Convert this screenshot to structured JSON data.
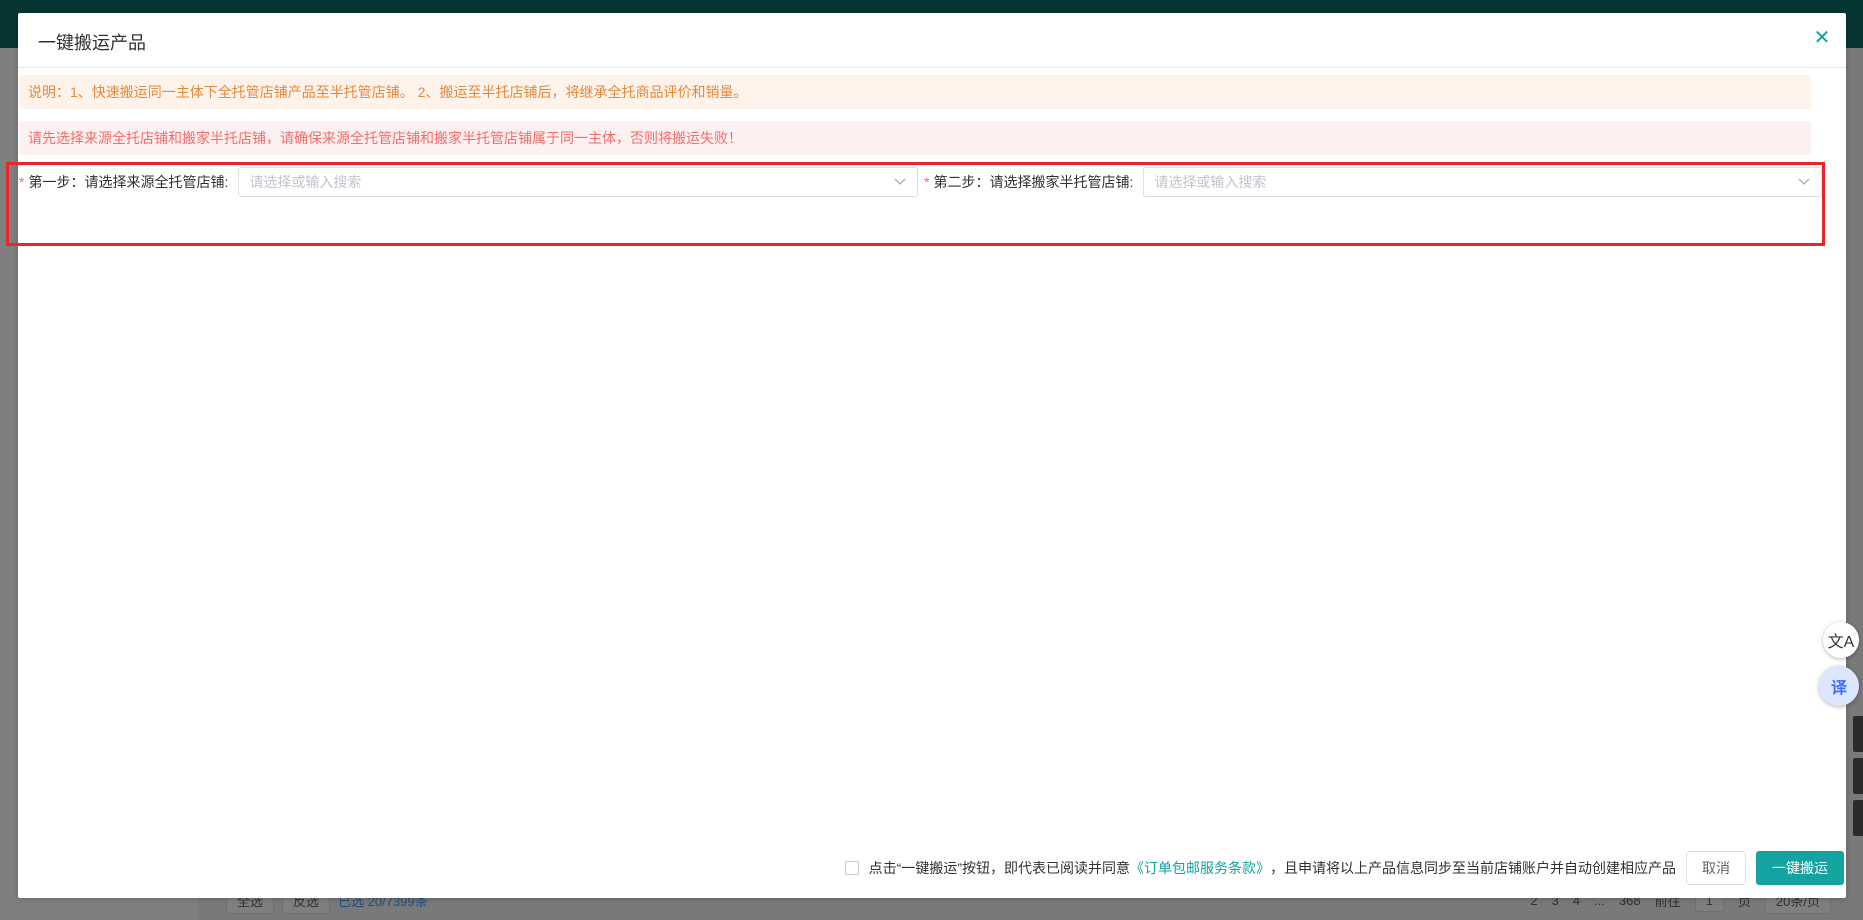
{
  "dialog": {
    "title": "一键搬运产品",
    "close_icon": "close-icon"
  },
  "notices": {
    "info": "说明：1、快速搬运同一主体下全托管店铺产品至半托管店铺。 2、搬运至半托店铺后，将继承全托商品评价和销量。",
    "warning": "请先选择来源全托店铺和搬家半托店铺，请确保来源全托管店铺和搬家半托管店铺属于同一主体，否则将搬运失败！"
  },
  "step1": {
    "required_mark": "*",
    "label": "第一步：请选择来源全托管店铺:",
    "placeholder": "请选择或输入搜索"
  },
  "step2": {
    "required_mark": "*",
    "label": "第二步：请选择搬家半托管店铺:",
    "placeholder": "请选择或输入搜索"
  },
  "footer": {
    "agree_prefix": "点击“一键搬运”按钮，即代表已阅读并同意",
    "agree_link": "《订单包邮服务条款》",
    "agree_suffix": "，且申请将以上产品信息同步至当前店铺账户并自动创建相应产品",
    "cancel_label": "取消",
    "submit_label": "一键搬运"
  },
  "background": {
    "select_all": "全选",
    "invert": "反选",
    "selected_count": "已选 20/7399条",
    "pages": [
      "2",
      "3",
      "4",
      "...",
      "368"
    ],
    "goto": "前往",
    "goto_page": "1",
    "page_unit": "页",
    "page_size": "20条/页"
  },
  "colors": {
    "accent": "#13a3a0",
    "highlight_border": "#e8262a",
    "warning_text": "#e6893c",
    "error_text": "#f56c6c"
  }
}
